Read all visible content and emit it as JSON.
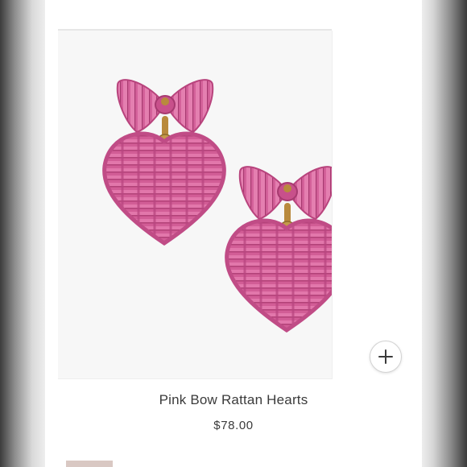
{
  "product": {
    "name": "Pink Bow Rattan Hearts",
    "price": "$78.00",
    "image_subject": "pink-rattan-heart-bow-earrings",
    "colors": {
      "rattan_pink": "#d9609a",
      "rattan_dark": "#a83a70",
      "rattan_light": "#ef97c1",
      "gold_hardware": "#b98a3d"
    }
  },
  "controls": {
    "zoom_icon": "plus-icon"
  }
}
